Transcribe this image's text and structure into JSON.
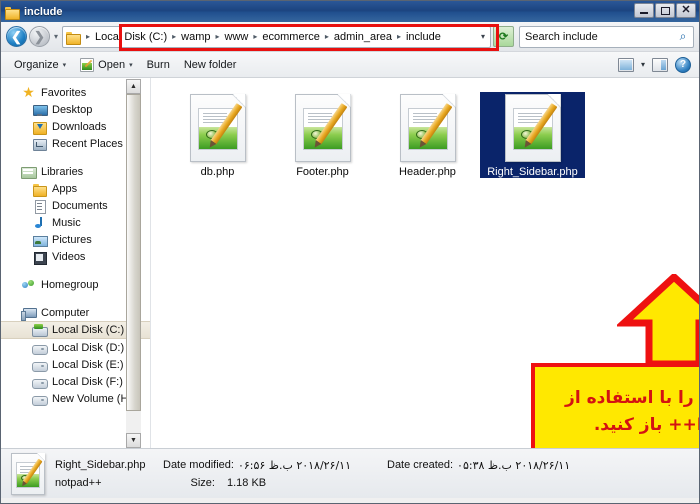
{
  "window": {
    "title": "include",
    "folder_icon": "folder-icon",
    "minimize_label": "",
    "maximize_label": "",
    "close_label": "✕"
  },
  "nav": {
    "back_label": "❮",
    "forward_label": "❯",
    "recent_chevron": "▾",
    "breadcrumbs": [
      "Local Disk (C:)",
      "wamp",
      "www",
      "ecommerce",
      "admin_area",
      "include"
    ],
    "separator": "▸",
    "dropdown_arrow": "▾",
    "refresh_label": "⟳",
    "search": {
      "value": "Search include",
      "placeholder": "Search include",
      "icon": "search-icon",
      "icon_glyph": "⌕"
    }
  },
  "toolbar": {
    "organize_label": "Organize",
    "organize_caret": "▾",
    "open_label": "Open",
    "open_caret": "▾",
    "burn_label": "Burn",
    "new_folder_label": "New folder",
    "view_caret": "▾",
    "help_label": "?"
  },
  "sidebar": {
    "groups": [
      {
        "header": {
          "label": "Favorites",
          "icon": "star-icon"
        },
        "items": [
          {
            "label": "Desktop",
            "icon": "desktop-icon"
          },
          {
            "label": "Downloads",
            "icon": "downloads-icon"
          },
          {
            "label": "Recent Places",
            "icon": "recent-places-icon"
          }
        ]
      },
      {
        "header": {
          "label": "Libraries",
          "icon": "libraries-icon"
        },
        "items": [
          {
            "label": "Apps",
            "icon": "folder-icon"
          },
          {
            "label": "Documents",
            "icon": "document-icon"
          },
          {
            "label": "Music",
            "icon": "music-icon"
          },
          {
            "label": "Pictures",
            "icon": "pictures-icon"
          },
          {
            "label": "Videos",
            "icon": "videos-icon"
          }
        ]
      },
      {
        "header": {
          "label": "Homegroup",
          "icon": "homegroup-icon"
        },
        "items": []
      },
      {
        "header": {
          "label": "Computer",
          "icon": "computer-icon"
        },
        "items": [
          {
            "label": "Local Disk (C:)",
            "icon": "system-drive-icon",
            "selected": true
          },
          {
            "label": "Local Disk (D:)",
            "icon": "drive-icon"
          },
          {
            "label": "Local Disk (E:)",
            "icon": "drive-icon"
          },
          {
            "label": "Local Disk (F:)",
            "icon": "drive-icon"
          },
          {
            "label": "New Volume (H:)",
            "icon": "drive-icon"
          }
        ]
      }
    ],
    "scroll_up": "▲",
    "scroll_down": "▼"
  },
  "files": [
    {
      "name": "db.php",
      "icon": "notepadpp-file-icon",
      "selected": false
    },
    {
      "name": "Footer.php",
      "icon": "notepadpp-file-icon",
      "selected": false
    },
    {
      "name": "Header.php",
      "icon": "notepadpp-file-icon",
      "selected": false
    },
    {
      "name": "Right_Sidebar.php",
      "icon": "notepadpp-file-icon",
      "selected": true
    }
  ],
  "annotation": {
    "arrow": "up-arrow",
    "lines": [
      "باید این فایل را با استفاده از",
      "Notepad++ باز کنید."
    ],
    "box_fill": "#ffe800",
    "box_border": "#ee1111",
    "text_color": "#d41212"
  },
  "details": {
    "file_name": "Right_Sidebar.php",
    "file_type": "notpad++",
    "date_modified_label": "Date modified:",
    "date_modified_value": "۲۰۱۸/۲۶/۱۱ ب.ظ ۰۶:۵۶",
    "date_created_label": "Date created:",
    "date_created_value": "۲۰۱۸/۲۶/۱۱ ب.ظ ۰۵:۳۸",
    "size_label": "Size:",
    "size_value": "1.18 KB",
    "icon": "notepadpp-file-icon"
  },
  "highlight": {
    "address_bar_outline_color": "#e8100f"
  }
}
